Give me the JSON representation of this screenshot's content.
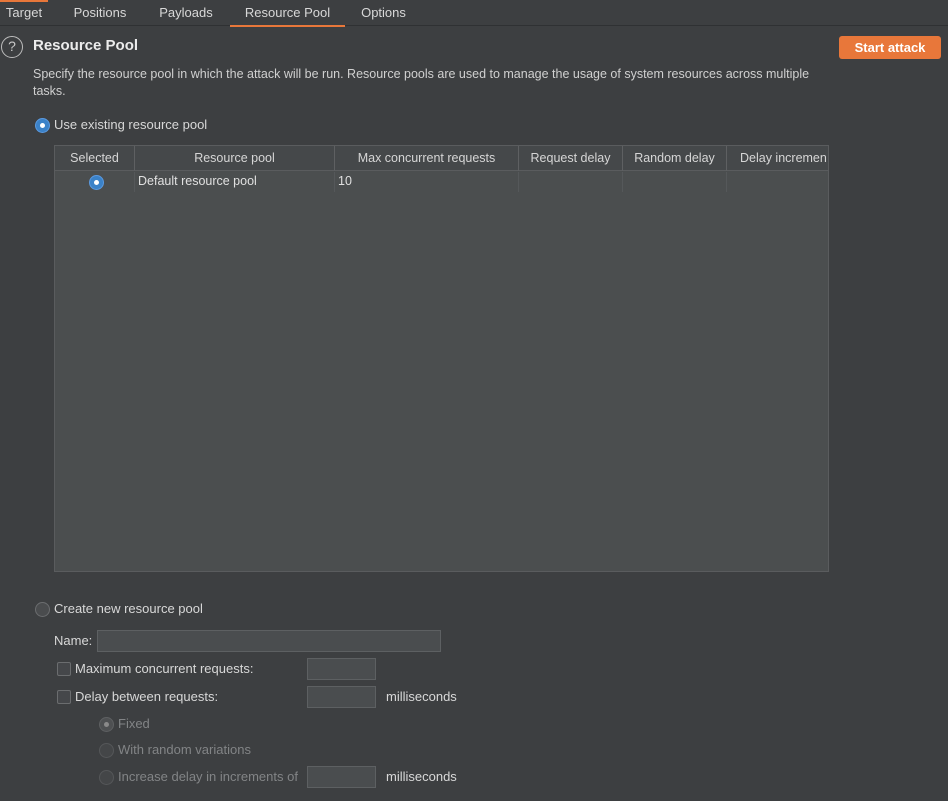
{
  "tabs": [
    {
      "label": "Target",
      "active": false
    },
    {
      "label": "Positions",
      "active": false
    },
    {
      "label": "Payloads",
      "active": false
    },
    {
      "label": "Resource Pool",
      "active": true
    },
    {
      "label": "Options",
      "active": false
    }
  ],
  "section": {
    "title": "Resource Pool",
    "help_icon_glyph": "?",
    "description": "Specify the resource pool in which the attack will be run. Resource pools are used to manage the usage of system resources across multiple tasks."
  },
  "actions": {
    "start_attack": "Start attack"
  },
  "existing_pool": {
    "radio_label": "Use existing resource pool",
    "selected": true,
    "columns": [
      "Selected",
      "Resource pool",
      "Max concurrent requests",
      "Request delay",
      "Random delay",
      "Delay incremen"
    ],
    "rows": [
      {
        "selected": true,
        "name": "Default resource pool",
        "max_concurrent": "10",
        "request_delay": "",
        "random_delay": "",
        "delay_increment": ""
      }
    ]
  },
  "new_pool": {
    "radio_label": "Create new resource pool",
    "selected": false,
    "name_label": "Name:",
    "name_value": "",
    "max_concurrent_label": "Maximum concurrent requests:",
    "max_concurrent_value": "",
    "delay_label": "Delay between requests:",
    "delay_value": "",
    "delay_unit": "milliseconds",
    "delay_options": {
      "fixed": "Fixed",
      "random": "With random variations",
      "increase": "Increase delay in increments of",
      "increase_value": "",
      "increase_unit": "milliseconds"
    }
  },
  "colors": {
    "accent": "#e8773a",
    "radio_selected": "#3b82c8",
    "background": "#3d3f41",
    "table_background": "#4b4e4f"
  }
}
